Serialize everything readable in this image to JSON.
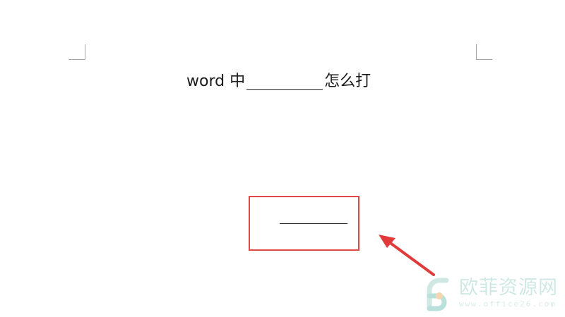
{
  "document": {
    "heading_prefix": "word 中",
    "heading_suffix": "怎么打"
  },
  "annotation": {
    "box_color": "#e04848",
    "arrow_color": "#e03a3a"
  },
  "watermark": {
    "title": "欧菲资源网",
    "url": "www.office26.com",
    "logo_icon": "office26-logo-icon"
  }
}
